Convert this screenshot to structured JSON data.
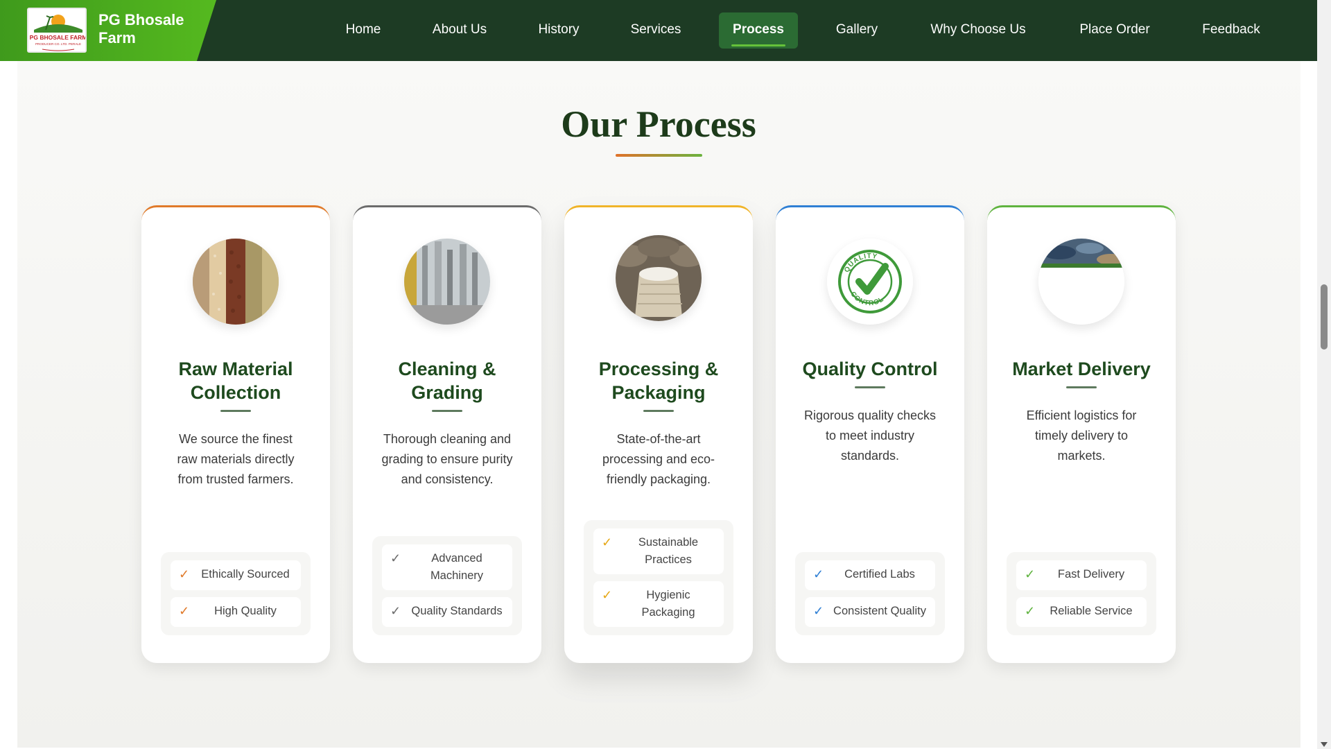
{
  "brand": {
    "logo_text": "PG BHOSALE FARM",
    "logo_subtext": "PRODUCER CO. LTD. PERALE",
    "name_line1": "PG Bhosale",
    "name_line2": "Farm"
  },
  "nav": {
    "items": [
      {
        "label": "Home"
      },
      {
        "label": "About Us"
      },
      {
        "label": "History"
      },
      {
        "label": "Services"
      },
      {
        "label": "Process",
        "active": true
      },
      {
        "label": "Gallery"
      },
      {
        "label": "Why Choose Us"
      },
      {
        "label": "Place Order"
      },
      {
        "label": "Feedback"
      }
    ]
  },
  "section": {
    "title": "Our Process"
  },
  "cards": [
    {
      "title": "Raw Material Collection",
      "description": "We source the finest raw materials directly from trusted farmers.",
      "accent": "#e07a2a",
      "check_color": "#e07a2a",
      "image_icon": "grains-photo",
      "features": [
        "Ethically Sourced",
        "High Quality"
      ]
    },
    {
      "title": "Cleaning & Grading",
      "description": "Thorough cleaning and grading to ensure purity and consistency.",
      "accent": "#6b6b6b",
      "check_color": "#6b6b6b",
      "image_icon": "factory-machinery-photo",
      "features": [
        "Advanced Machinery",
        "Quality Standards"
      ]
    },
    {
      "title": "Processing & Packaging",
      "description": "State-of-the-art processing and eco-friendly packaging.",
      "accent": "#f0b429",
      "check_color": "#e6a817",
      "image_icon": "grain-sack-photo",
      "features": [
        "Sustainable Practices",
        "Hygienic Packaging"
      ]
    },
    {
      "title": "Quality Control",
      "description": "Rigorous quality checks to meet industry standards.",
      "accent": "#2f7fd4",
      "check_color": "#2f7fd4",
      "image_icon": "quality-control-seal",
      "seal_top": "QUALITY",
      "seal_bottom": "CONTROL",
      "features": [
        "Certified Labs",
        "Consistent Quality"
      ]
    },
    {
      "title": "Market Delivery",
      "description": "Efficient logistics for timely delivery to markets.",
      "accent": "#5fb33f",
      "check_color": "#5fb33f",
      "image_icon": "market-photo",
      "features": [
        "Fast Delivery",
        "Reliable Service"
      ]
    }
  ],
  "check_symbol": "✓"
}
